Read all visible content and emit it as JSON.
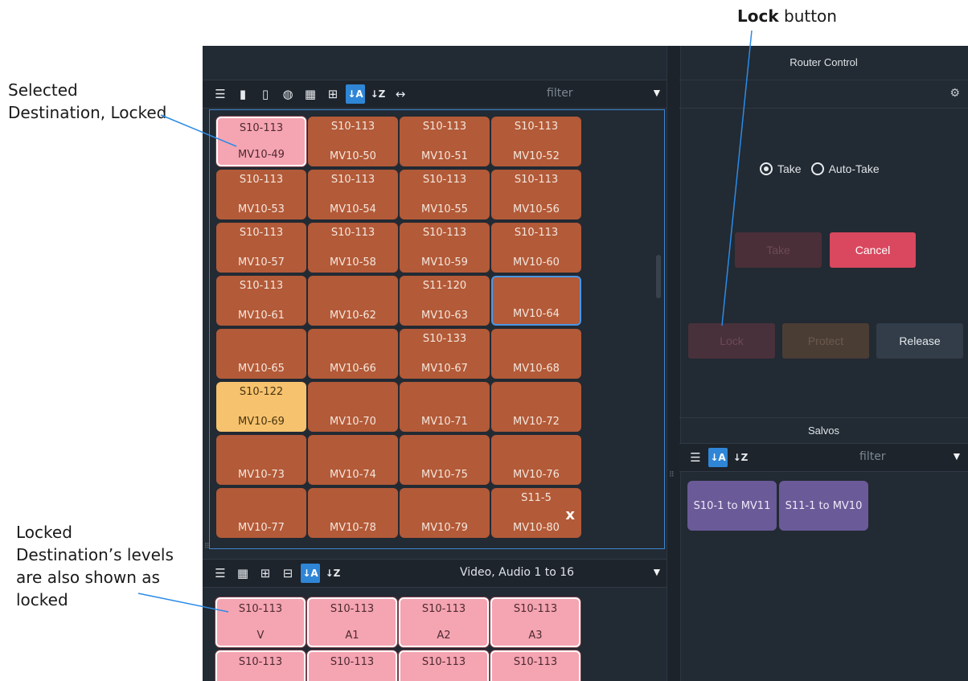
{
  "annotations": {
    "lock_button_bold": "Lock",
    "lock_button_rest": " button",
    "selected_locked_line1": "Selected",
    "selected_locked_line2": "Destination, Locked",
    "levels_line1": "Locked",
    "levels_line2": "Destination’s levels",
    "levels_line3": "are also shown as",
    "levels_line4": "locked"
  },
  "destinations": {
    "filter_placeholder": "filter",
    "tiles": [
      {
        "src": "S10-113",
        "dst": "MV10-49",
        "state": "locked"
      },
      {
        "src": "S10-113",
        "dst": "MV10-50"
      },
      {
        "src": "S10-113",
        "dst": "MV10-51"
      },
      {
        "src": "S10-113",
        "dst": "MV10-52"
      },
      {
        "src": "S10-113",
        "dst": "MV10-53"
      },
      {
        "src": "S10-113",
        "dst": "MV10-54"
      },
      {
        "src": "S10-113",
        "dst": "MV10-55"
      },
      {
        "src": "S10-113",
        "dst": "MV10-56"
      },
      {
        "src": "S10-113",
        "dst": "MV10-57"
      },
      {
        "src": "S10-113",
        "dst": "MV10-58"
      },
      {
        "src": "S10-113",
        "dst": "MV10-59"
      },
      {
        "src": "S10-113",
        "dst": "MV10-60"
      },
      {
        "src": "S10-113",
        "dst": "MV10-61"
      },
      {
        "src": "",
        "dst": "MV10-62"
      },
      {
        "src": "S11-120",
        "dst": "MV10-63"
      },
      {
        "src": "",
        "dst": "MV10-64",
        "state": "focus"
      },
      {
        "src": "",
        "dst": "MV10-65"
      },
      {
        "src": "",
        "dst": "MV10-66"
      },
      {
        "src": "S10-133",
        "dst": "MV10-67"
      },
      {
        "src": "",
        "dst": "MV10-68"
      },
      {
        "src": "S10-122",
        "dst": "MV10-69",
        "state": "yellow"
      },
      {
        "src": "",
        "dst": "MV10-70"
      },
      {
        "src": "",
        "dst": "MV10-71"
      },
      {
        "src": "",
        "dst": "MV10-72"
      },
      {
        "src": "",
        "dst": "MV10-73"
      },
      {
        "src": "",
        "dst": "MV10-74"
      },
      {
        "src": "",
        "dst": "MV10-75"
      },
      {
        "src": "",
        "dst": "MV10-76"
      },
      {
        "src": "",
        "dst": "MV10-77"
      },
      {
        "src": "",
        "dst": "MV10-78"
      },
      {
        "src": "",
        "dst": "MV10-79"
      },
      {
        "src": "S11-5",
        "dst": "MV10-80",
        "icon": "x-icon"
      }
    ]
  },
  "levels": {
    "filter_label": "Video, Audio 1 to 16",
    "tiles": [
      {
        "src": "S10-113",
        "dst": "V"
      },
      {
        "src": "S10-113",
        "dst": "A1"
      },
      {
        "src": "S10-113",
        "dst": "A2"
      },
      {
        "src": "S10-113",
        "dst": "A3"
      },
      {
        "src": "S10-113",
        "dst": ""
      },
      {
        "src": "S10-113",
        "dst": ""
      },
      {
        "src": "S10-113",
        "dst": ""
      },
      {
        "src": "S10-113",
        "dst": ""
      }
    ]
  },
  "router_control": {
    "title": "Router Control",
    "take_radio": "Take",
    "auto_take_radio": "Auto-Take",
    "take_button": "Take",
    "cancel_button": "Cancel",
    "lock_button": "Lock",
    "protect_button": "Protect",
    "release_button": "Release"
  },
  "salvos": {
    "title": "Salvos",
    "filter_placeholder": "filter",
    "items": [
      "S10-1 to MV11",
      "S11-1 to MV10"
    ]
  },
  "colors": {
    "dest_tile": "#b35a38",
    "locked_tile": "#f5a4b2",
    "yellow_tile": "#f6c26e",
    "salvo": "#6a5a98",
    "cancel": "#d9485f",
    "accent": "#2f86d6"
  }
}
